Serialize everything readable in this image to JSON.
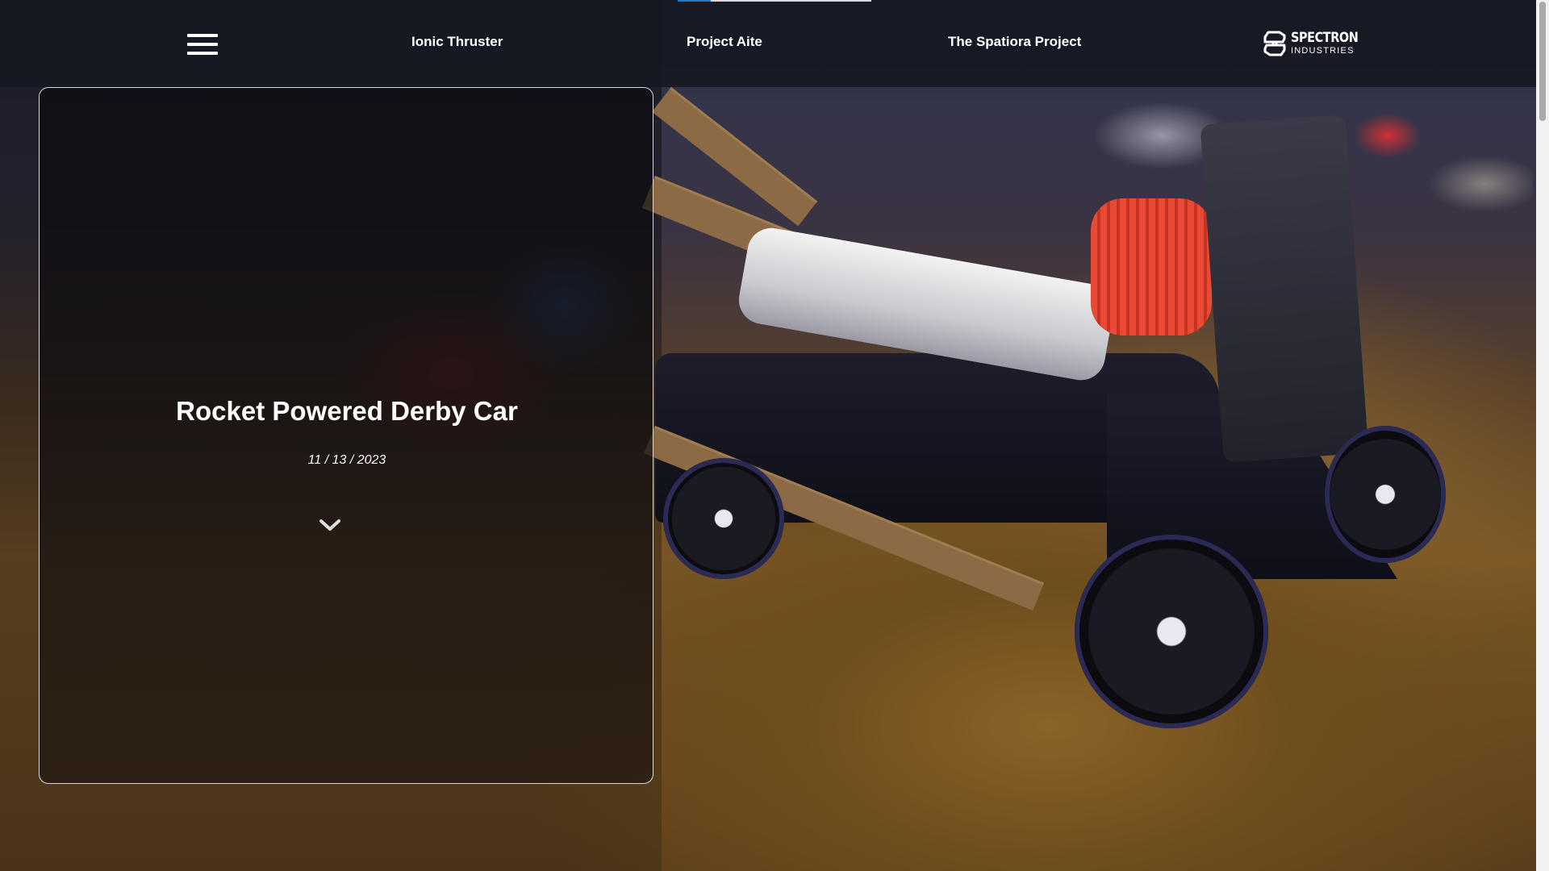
{
  "header": {
    "menu_icon": "hamburger-menu-icon",
    "nav": [
      {
        "label": "Ionic Thruster"
      },
      {
        "label": "Project Aite"
      },
      {
        "label": "The Spatiora Project"
      }
    ],
    "logo": {
      "line1": "SPECTRON",
      "line2": "INDUSTRIES",
      "icon": "spectron-s-logo-icon"
    },
    "reading_progress_fraction": 0.17,
    "accent_color": "#1f7bd0"
  },
  "hero": {
    "title": "Rocket Powered Derby Car",
    "date": "11 / 13 / 2023",
    "scroll_icon": "chevron-down-icon",
    "background_image": "rocket-powered-derby-car-photo"
  },
  "scrollbar": {
    "position_fraction": 0.0
  }
}
